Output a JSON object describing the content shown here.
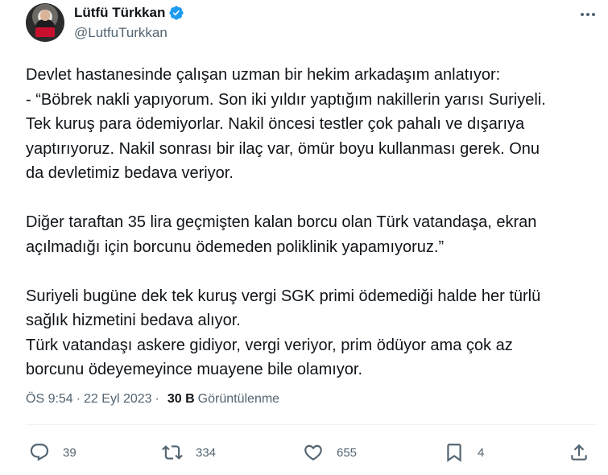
{
  "author": {
    "name": "Lütfü Türkkan",
    "handle": "@LutfuTurkkan",
    "verified_color": "#1d9bf0"
  },
  "tweet": {
    "lines": [
      "Devlet hastanesinde çalışan uzman bir hekim arkadaşım anlatıyor:",
      "- “Böbrek nakli yapıyorum. Son iki yıldır yaptığım nakillerin yarısı Suriyeli.",
      "Tek kuruş para ödemiyorlar. Nakil öncesi testler çok pahalı ve dışarıya",
      "yaptırıyoruz. Nakil sonrası bir ilaç var, ömür boyu kullanması gerek. Onu",
      "da devletimiz bedava veriyor.",
      "",
      "Diğer taraftan 35 lira geçmişten kalan borcu olan Türk vatandaşa, ekran",
      "açılmadığı için borcunu ödemeden poliklinik yapamıyoruz.”",
      "",
      "Suriyeli bugüne dek tek kuruş vergi SGK primi ödemediği halde her türlü",
      "sağlık hizmetini bedava alıyor.",
      "Türk vatandaşı askere gidiyor, vergi veriyor, prim ödüyor ama çok az",
      "borcunu ödeyemeyince muayene bile olamıyor."
    ]
  },
  "meta": {
    "time": "ÖS 9:54",
    "separator": "·",
    "date": "22 Eyl 2023",
    "views_count": "30 B",
    "views_label": "Görüntülenme"
  },
  "actions": {
    "replies": "39",
    "reposts": "334",
    "likes": "655",
    "bookmarks": "4"
  },
  "icons": [
    "verified-icon",
    "more-icon",
    "reply-icon",
    "repost-icon",
    "like-icon",
    "bookmark-icon",
    "share-icon"
  ]
}
